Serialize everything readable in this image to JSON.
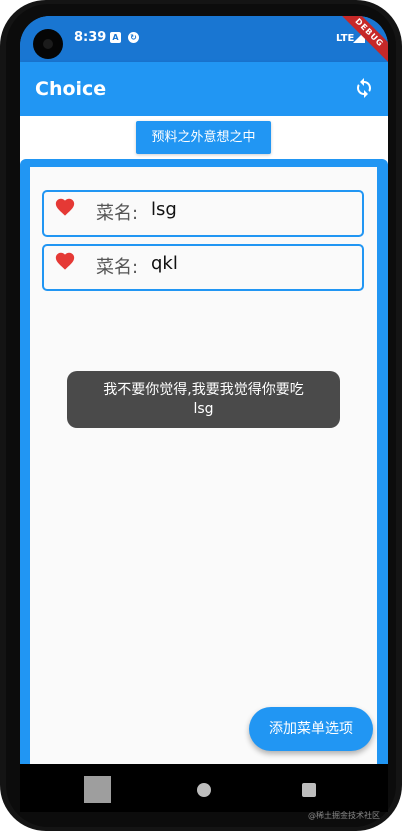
{
  "status_bar": {
    "time": "8:39",
    "network": "LTE",
    "debug_banner": "DEBUG"
  },
  "app_bar": {
    "title": "Choice",
    "action_icon": "refresh-icon"
  },
  "top_button": {
    "label": "预料之外意想之中"
  },
  "dishes": [
    {
      "prefix": "菜名:",
      "name": "lsg",
      "icon": "heart-icon"
    },
    {
      "prefix": "菜名:",
      "name": "qkl",
      "icon": "heart-icon"
    }
  ],
  "toast": {
    "line1": "我不要你觉得,我要我觉得你要吃",
    "line2": "lsg"
  },
  "fab": {
    "label": "添加菜单选项"
  },
  "watermark": "@稀土掘金技术社区",
  "colors": {
    "primary": "#2196f3",
    "status_bar": "#1976d2",
    "heart": "#e53935",
    "toast_bg": "#4a4a4a"
  }
}
